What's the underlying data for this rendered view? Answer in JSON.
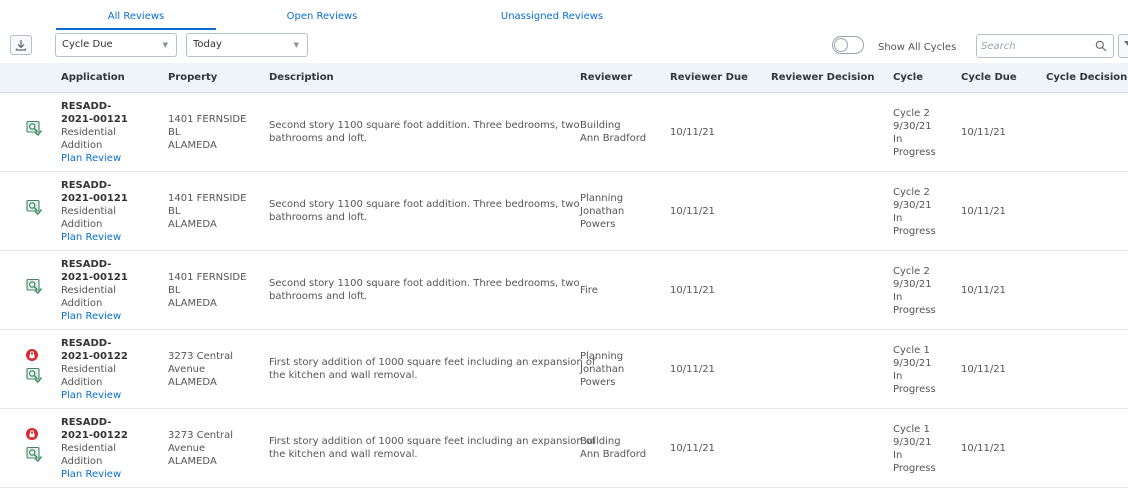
{
  "tabs": [
    {
      "label": "All Reviews",
      "active": true
    },
    {
      "label": "Open Reviews",
      "active": false
    },
    {
      "label": "Unassigned Reviews",
      "active": false
    }
  ],
  "toolbar": {
    "download_icon": "download-icon",
    "filter1_value": "Cycle Due",
    "filter2_value": "Today",
    "toggle_label": "Show All Cycles",
    "toggle_on": false,
    "search_placeholder": "Search",
    "filter_icon": "filter-icon"
  },
  "columns": {
    "application": "Application",
    "property": "Property",
    "description": "Description",
    "reviewer": "Reviewer",
    "reviewer_due": "Reviewer Due",
    "reviewer_decision": "Reviewer Decision",
    "cycle": "Cycle",
    "cycle_due": "Cycle Due",
    "cycle_decision": "Cycle Decision"
  },
  "rows": [
    {
      "locked": false,
      "app_line1": "RESADD-",
      "app_line2": "2021-00121",
      "app_type1": "Residential",
      "app_type2": "Addition",
      "app_link": "Plan Review",
      "prop_line1": "1401 FERNSIDE",
      "prop_line2": "BL",
      "prop_line3": "ALAMEDA",
      "desc_line1": "Second story 1100 square foot addition. Three bedrooms, two",
      "desc_line2": "bathrooms and loft.",
      "rev_line1": "Building",
      "rev_line2": "Ann Bradford",
      "rev_line3": "",
      "reviewer_due": "10/11/21",
      "reviewer_decision": "",
      "cycle_line1": "Cycle 2",
      "cycle_line2": "9/30/21",
      "cycle_line3": "In",
      "cycle_line4": "Progress",
      "cycle_due": "10/11/21",
      "cycle_decision": ""
    },
    {
      "locked": false,
      "app_line1": "RESADD-",
      "app_line2": "2021-00121",
      "app_type1": "Residential",
      "app_type2": "Addition",
      "app_link": "Plan Review",
      "prop_line1": "1401 FERNSIDE",
      "prop_line2": "BL",
      "prop_line3": "ALAMEDA",
      "desc_line1": "Second story 1100 square foot addition. Three bedrooms, two",
      "desc_line2": "bathrooms and loft.",
      "rev_line1": "Planning",
      "rev_line2": "Jonathan",
      "rev_line3": "Powers",
      "reviewer_due": "10/11/21",
      "reviewer_decision": "",
      "cycle_line1": "Cycle 2",
      "cycle_line2": "9/30/21",
      "cycle_line3": "In",
      "cycle_line4": "Progress",
      "cycle_due": "10/11/21",
      "cycle_decision": ""
    },
    {
      "locked": false,
      "app_line1": "RESADD-",
      "app_line2": "2021-00121",
      "app_type1": "Residential",
      "app_type2": "Addition",
      "app_link": "Plan Review",
      "prop_line1": "1401 FERNSIDE",
      "prop_line2": "BL",
      "prop_line3": "ALAMEDA",
      "desc_line1": "Second story 1100 square foot addition. Three bedrooms, two",
      "desc_line2": "bathrooms and loft.",
      "rev_line1": "Fire",
      "rev_line2": "",
      "rev_line3": "",
      "reviewer_due": "10/11/21",
      "reviewer_decision": "",
      "cycle_line1": "Cycle 2",
      "cycle_line2": "9/30/21",
      "cycle_line3": "In",
      "cycle_line4": "Progress",
      "cycle_due": "10/11/21",
      "cycle_decision": ""
    },
    {
      "locked": true,
      "app_line1": "RESADD-",
      "app_line2": "2021-00122",
      "app_type1": "Residential",
      "app_type2": "Addition",
      "app_link": "Plan Review",
      "prop_line1": "3273 Central",
      "prop_line2": "Avenue",
      "prop_line3": "ALAMEDA",
      "desc_line1": "First story addition of 1000 square feet including an expansion of",
      "desc_line2": "the kitchen and wall removal.",
      "rev_line1": "Planning",
      "rev_line2": "Jonathan",
      "rev_line3": "Powers",
      "reviewer_due": "10/11/21",
      "reviewer_decision": "",
      "cycle_line1": "Cycle 1",
      "cycle_line2": "9/30/21",
      "cycle_line3": "In",
      "cycle_line4": "Progress",
      "cycle_due": "10/11/21",
      "cycle_decision": ""
    },
    {
      "locked": true,
      "app_line1": "RESADD-",
      "app_line2": "2021-00122",
      "app_type1": "Residential",
      "app_type2": "Addition",
      "app_link": "Plan Review",
      "prop_line1": "3273 Central",
      "prop_line2": "Avenue",
      "prop_line3": "ALAMEDA",
      "desc_line1": "First story addition of 1000 square feet including an expansion of",
      "desc_line2": "the kitchen and wall removal.",
      "rev_line1": "Building",
      "rev_line2": "Ann Bradford",
      "rev_line3": "",
      "reviewer_due": "10/11/21",
      "reviewer_decision": "",
      "cycle_line1": "Cycle 1",
      "cycle_line2": "9/30/21",
      "cycle_line3": "In",
      "cycle_line4": "Progress",
      "cycle_due": "10/11/21",
      "cycle_decision": ""
    }
  ],
  "icons": {
    "lock": "lock-icon",
    "plan_review": "plan-review-icon"
  },
  "colors": {
    "accent": "#0a6ed1",
    "header_bg": "#eef4fa",
    "lock": "#d9262c",
    "plan_icon": "#2e8b57"
  }
}
